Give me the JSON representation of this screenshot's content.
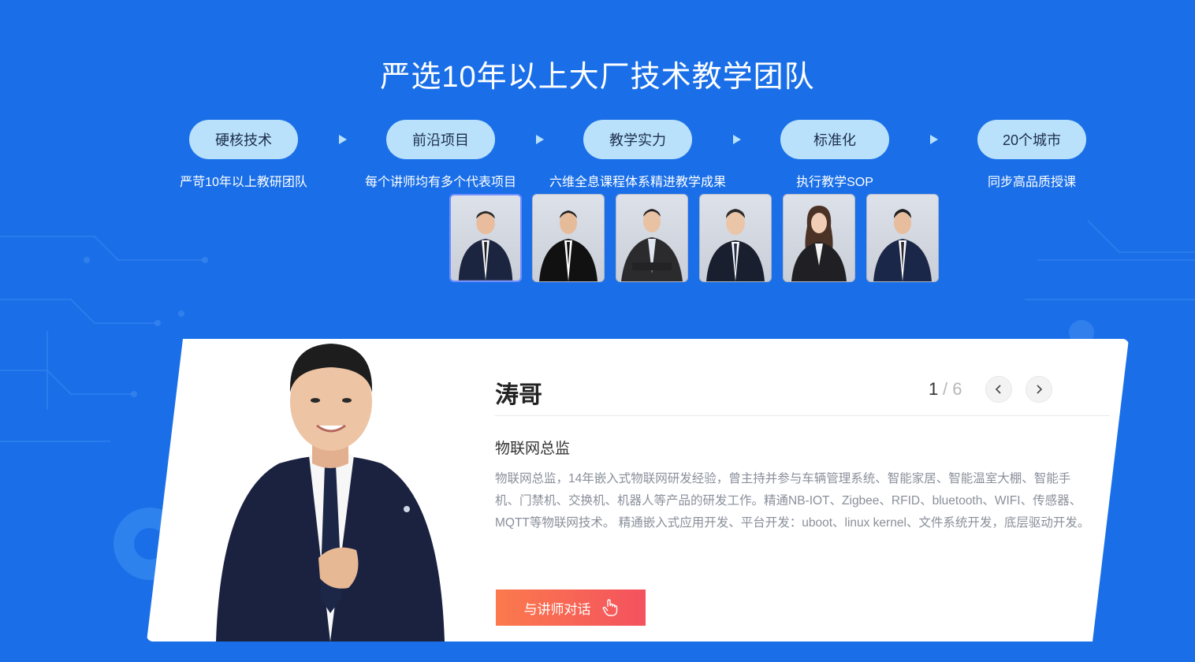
{
  "section": {
    "title": "严选10年以上大厂技术教学团队"
  },
  "steps": [
    {
      "label": "硬核技术",
      "sub": "严苛10年以上教研团队"
    },
    {
      "label": "前沿项目",
      "sub": "每个讲师均有多个代表项目"
    },
    {
      "label": "教学实力",
      "sub": "六维全息课程体系精进教学成果"
    },
    {
      "label": "标准化",
      "sub": "执行教学SOP"
    },
    {
      "label": "20个城市",
      "sub": "同步高品质授课"
    }
  ],
  "thumbnails": {
    "count": 6,
    "active_index": 0
  },
  "teacher": {
    "name": "涛哥",
    "pager_current": "1",
    "pager_total": "/ 6",
    "role": "物联网总监",
    "description": "物联网总监，14年嵌入式物联网研发经验，曾主持并参与车辆管理系统、智能家居、智能温室大棚、智能手机、门禁机、交换机、机器人等产品的研发工作。精通NB-IOT、Zigbee、RFID、bluetooth、WIFI、传感器、MQTT等物联网技术。 精通嵌入式应用开发、平台开发：uboot、linux kernel、文件系统开发，底层驱动开发。",
    "chat_button": "与讲师对话"
  },
  "icons": {
    "step_arrow": "triangle-right-icon",
    "prev": "chevron-left-icon",
    "next": "chevron-right-icon",
    "chat": "hand-pointer-icon"
  },
  "colors": {
    "background": "#1a6fe8",
    "pill": "#b9e1fb",
    "button_start": "#fb7a4d",
    "button_end": "#f4525e"
  }
}
